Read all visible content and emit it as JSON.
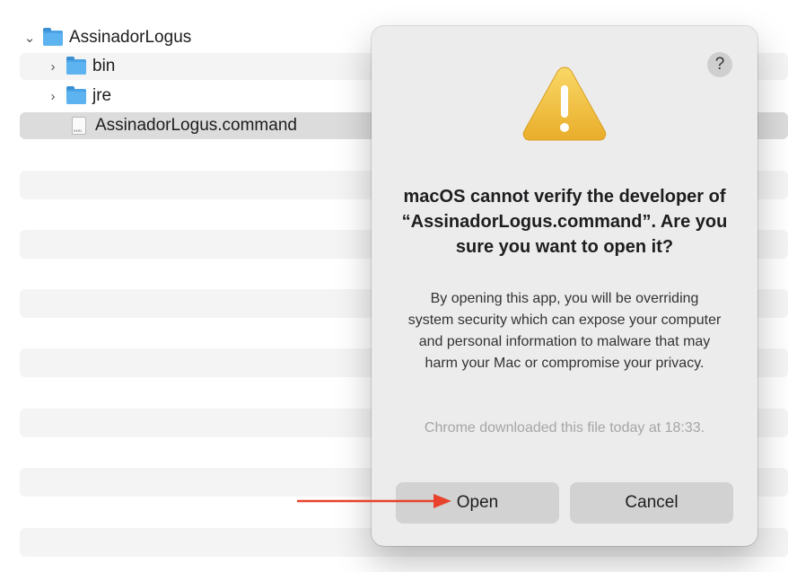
{
  "finder": {
    "items": [
      {
        "name": "AssinadorLogus",
        "kind": "folder",
        "expanded": true
      },
      {
        "name": "bin",
        "kind": "folder",
        "expanded": false
      },
      {
        "name": "jre",
        "kind": "folder",
        "expanded": false
      },
      {
        "name": "AssinadorLogus.command",
        "kind": "file",
        "selected": true
      }
    ]
  },
  "dialog": {
    "help_label": "?",
    "icon": "warning-triangle-icon",
    "title": "macOS cannot verify the developer of “AssinadorLogus.command”. Are you sure you want to open it?",
    "body": "By opening this app, you will be overriding system security which can expose your computer and personal information to malware that may harm your Mac or compromise your privacy.",
    "note": "Chrome downloaded this file today at 18:33.",
    "buttons": {
      "open": "Open",
      "cancel": "Cancel"
    }
  },
  "annotation": {
    "arrow_color": "#e8412c"
  },
  "colors": {
    "warning_yellow": "#f5c84a",
    "folder_blue": "#4ba3e6",
    "dialog_bg": "#ececec",
    "button_bg": "#d2d2d2"
  }
}
